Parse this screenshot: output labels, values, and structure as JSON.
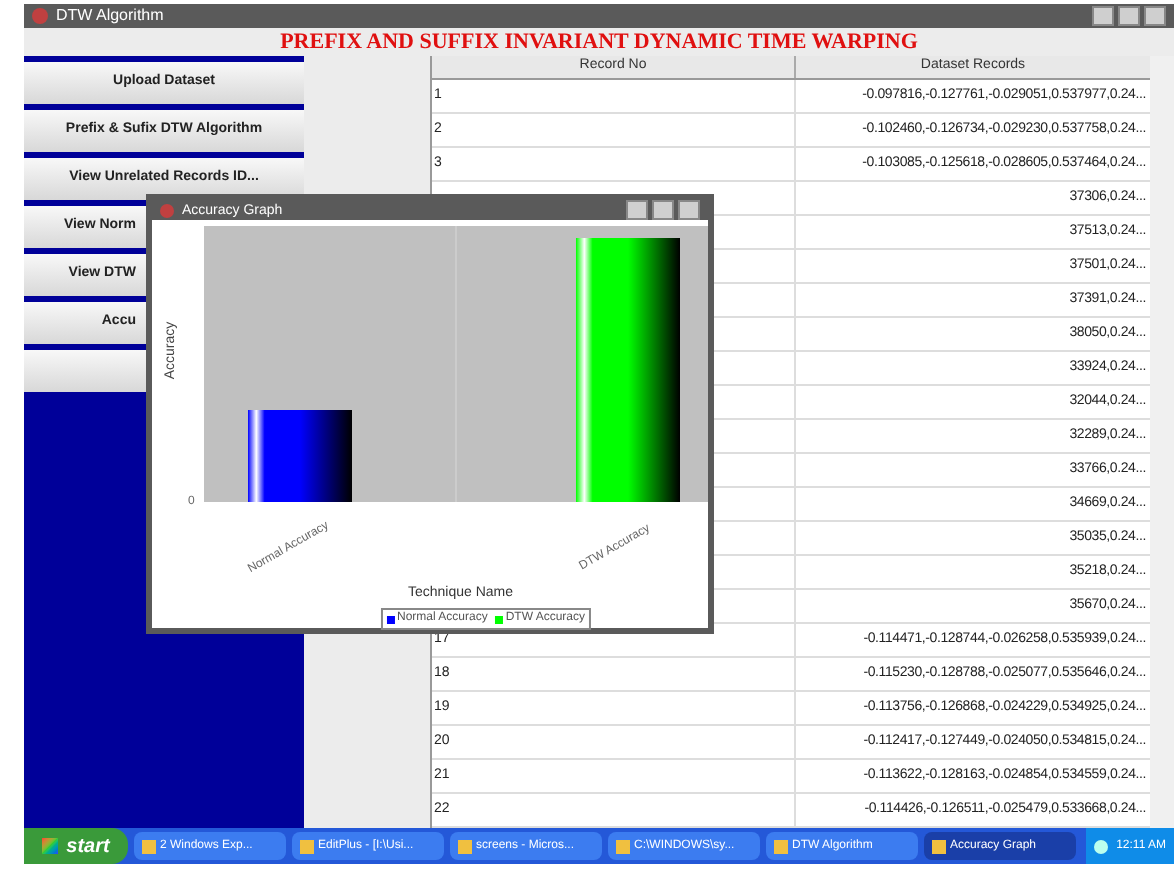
{
  "window": {
    "title": "DTW Algorithm"
  },
  "heading": "PREFIX AND SUFFIX INVARIANT DYNAMIC TIME WARPING",
  "buttons": [
    {
      "label": "Upload Dataset",
      "kind": "full"
    },
    {
      "label": "Prefix & Sufix DTW Algorithm",
      "kind": "full"
    },
    {
      "label": "View Unrelated Records ID...",
      "kind": "full"
    },
    {
      "label": "View Norm",
      "kind": "covered"
    },
    {
      "label": "View DTW",
      "kind": "covered"
    },
    {
      "label": "Accu",
      "kind": "covered"
    },
    {
      "kind": "full"
    }
  ],
  "table": {
    "columns": [
      "Record No",
      "Dataset Records"
    ],
    "rows": [
      [
        "1",
        "-0.097816,-0.127761,-0.029051,0.537977,0.24..."
      ],
      [
        "2",
        "-0.102460,-0.126734,-0.029230,0.537758,0.24..."
      ],
      [
        "3",
        "-0.103085,-0.125618,-0.028605,0.537464,0.24..."
      ],
      [
        null,
        "37306,0.24..."
      ],
      [
        null,
        "37513,0.24..."
      ],
      [
        null,
        "37501,0.24..."
      ],
      [
        null,
        "37391,0.24..."
      ],
      [
        null,
        "38050,0.24..."
      ],
      [
        null,
        "33924,0.24..."
      ],
      [
        null,
        "32044,0.24..."
      ],
      [
        null,
        "32289,0.24..."
      ],
      [
        null,
        "33766,0.24..."
      ],
      [
        null,
        "34669,0.24..."
      ],
      [
        null,
        "35035,0.24..."
      ],
      [
        null,
        "35218,0.24..."
      ],
      [
        null,
        "35670,0.24..."
      ],
      [
        "17",
        "-0.114471,-0.128744,-0.026258,0.535939,0.24..."
      ],
      [
        "18",
        "-0.115230,-0.128788,-0.025077,0.535646,0.24..."
      ],
      [
        "19",
        "-0.113756,-0.126868,-0.024229,0.534925,0.24..."
      ],
      [
        "20",
        "-0.112417,-0.127449,-0.024050,0.534815,0.24..."
      ],
      [
        "21",
        "-0.113622,-0.128163,-0.024854,0.534559,0.24..."
      ],
      [
        "22",
        "-0.114426,-0.126511,-0.025479,0.533668,0.24..."
      ]
    ]
  },
  "graph_window": {
    "title": "Accuracy Graph",
    "ylabel": "Accuracy",
    "ytick": "0",
    "xlabel": "Technique Name",
    "categories": [
      "Normal Accuracy",
      "DTW Accuracy"
    ],
    "series": [
      {
        "name": "Normal Accuracy",
        "color": "#0000ff"
      },
      {
        "name": "DTW Accuracy",
        "color": "#00ff00"
      }
    ]
  },
  "taskbar": {
    "start": "start",
    "items": [
      {
        "label": "2 Windows Exp...",
        "selected": false
      },
      {
        "label": "EditPlus - [I:\\Usi...",
        "selected": false
      },
      {
        "label": "screens - Micros...",
        "selected": false
      },
      {
        "label": "C:\\WINDOWS\\sy...",
        "selected": false
      },
      {
        "label": "DTW Algorithm",
        "selected": false
      },
      {
        "label": "Accuracy Graph",
        "selected": true
      }
    ],
    "clock": "12:11 AM"
  }
}
